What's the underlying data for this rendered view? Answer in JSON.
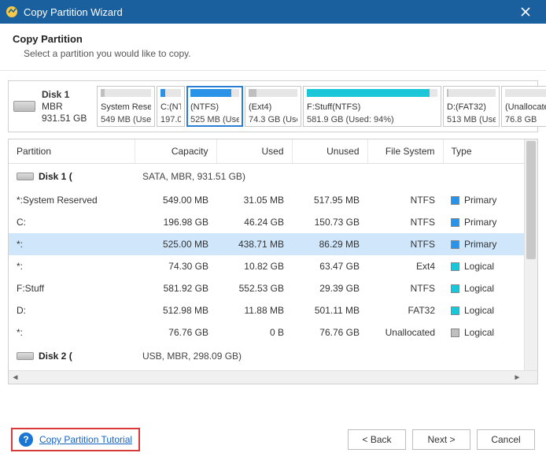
{
  "window": {
    "title": "Copy Partition Wizard"
  },
  "header": {
    "title": "Copy Partition",
    "subtitle": "Select a partition you would like to copy."
  },
  "disk": {
    "name": "Disk 1",
    "type": "MBR",
    "size": "931.51 GB"
  },
  "map_blocks": [
    {
      "line1": "System Rese",
      "line2": "549 MB (Use",
      "fill_pct": 8,
      "color": "#bfbfbf",
      "selected": false,
      "width": 74
    },
    {
      "line1": "C:(NT",
      "line2": "197.0",
      "fill_pct": 24,
      "color": "#2a93e8",
      "selected": false,
      "width": 36
    },
    {
      "line1": "(NTFS)",
      "line2": "525 MB (Use",
      "fill_pct": 84,
      "color": "#2a93e8",
      "selected": true,
      "width": 72
    },
    {
      "line1": "(Ext4)",
      "line2": "74.3 GB (Use",
      "fill_pct": 16,
      "color": "#bfbfbf",
      "selected": false,
      "width": 72
    },
    {
      "line1": "F:Stuff(NTFS)",
      "line2": "581.9 GB (Used: 94%)",
      "fill_pct": 94,
      "color": "#19c7d8",
      "selected": false,
      "width": 176
    },
    {
      "line1": "D:(FAT32)",
      "line2": "513 MB (Use",
      "fill_pct": 4,
      "color": "#bfbfbf",
      "selected": false,
      "width": 72
    },
    {
      "line1": "(Unallocated",
      "line2": "76.8 GB",
      "fill_pct": 0,
      "color": "#bfbfbf",
      "selected": false,
      "width": 72
    }
  ],
  "columns": {
    "partition": "Partition",
    "capacity": "Capacity",
    "used": "Used",
    "unused": "Unused",
    "fs": "File System",
    "type": "Type"
  },
  "disk_row_1": {
    "label": "Disk 1 (",
    "info": "SATA, MBR, 931.51 GB)"
  },
  "rows": [
    {
      "name": "*:System Reserved",
      "capacity": "549.00 MB",
      "used": "31.05 MB",
      "unused": "517.95 MB",
      "fs": "NTFS",
      "type": "Primary",
      "swatch": "#2a93e8",
      "selected": false
    },
    {
      "name": "C:",
      "capacity": "196.98 GB",
      "used": "46.24 GB",
      "unused": "150.73 GB",
      "fs": "NTFS",
      "type": "Primary",
      "swatch": "#2a93e8",
      "selected": false
    },
    {
      "name": "*:",
      "capacity": "525.00 MB",
      "used": "438.71 MB",
      "unused": "86.29 MB",
      "fs": "NTFS",
      "type": "Primary",
      "swatch": "#2a93e8",
      "selected": true
    },
    {
      "name": "*:",
      "capacity": "74.30 GB",
      "used": "10.82 GB",
      "unused": "63.47 GB",
      "fs": "Ext4",
      "type": "Logical",
      "swatch": "#19c7d8",
      "selected": false
    },
    {
      "name": "F:Stuff",
      "capacity": "581.92 GB",
      "used": "552.53 GB",
      "unused": "29.39 GB",
      "fs": "NTFS",
      "type": "Logical",
      "swatch": "#19c7d8",
      "selected": false
    },
    {
      "name": "D:",
      "capacity": "512.98 MB",
      "used": "11.88 MB",
      "unused": "501.11 MB",
      "fs": "FAT32",
      "type": "Logical",
      "swatch": "#19c7d8",
      "selected": false
    },
    {
      "name": "*:",
      "capacity": "76.76 GB",
      "used": "0 B",
      "unused": "76.76 GB",
      "fs": "Unallocated",
      "type": "Logical",
      "swatch": "#bfbfbf",
      "selected": false
    }
  ],
  "disk_row_2": {
    "label": "Disk 2 (",
    "info": "USB, MBR, 298.09 GB)"
  },
  "footer": {
    "tutorial": "Copy Partition Tutorial",
    "back": "<  Back",
    "next": "Next  >",
    "cancel": "Cancel"
  }
}
